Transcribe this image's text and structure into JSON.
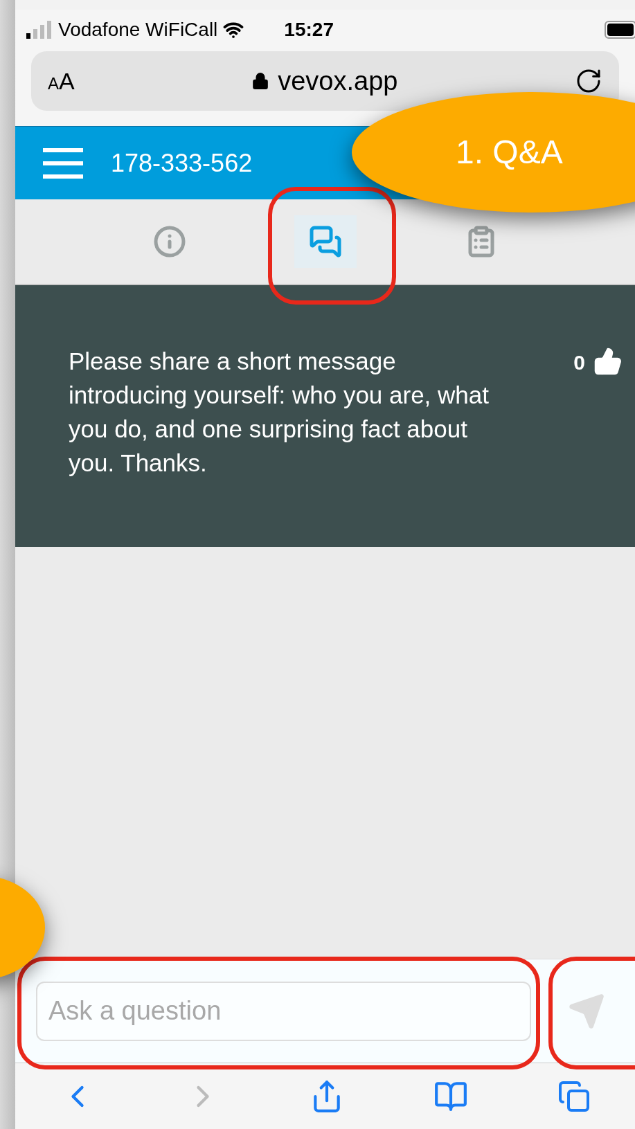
{
  "status_bar": {
    "carrier": "Vodafone WiFiCall",
    "time": "15:27"
  },
  "address_bar": {
    "text_size_button": "AA",
    "url": "vevox.app"
  },
  "header": {
    "session_id": "178-333-562"
  },
  "tabs": [
    {
      "kind": "info",
      "selected": false
    },
    {
      "kind": "chat",
      "selected": true
    },
    {
      "kind": "clipboard",
      "selected": false
    }
  ],
  "message": {
    "text": "Please share a short message introducing yourself: who you are, what you do, and one surprising fact about you. Thanks.",
    "votes": "0"
  },
  "question_input": {
    "placeholder": "Ask a question"
  },
  "callout": {
    "label": "1. Q&A"
  }
}
